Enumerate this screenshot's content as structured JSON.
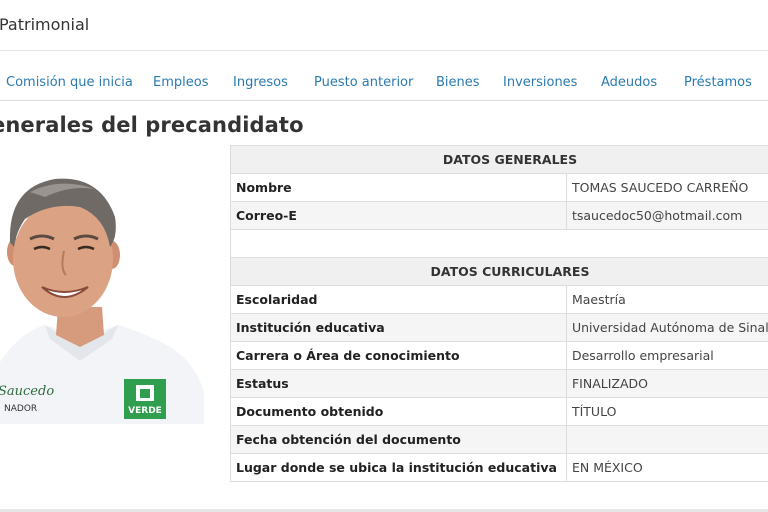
{
  "header": {
    "title": "Patrimonial"
  },
  "tabs": [
    {
      "label": "Comisión que inicia"
    },
    {
      "label": "Empleos"
    },
    {
      "label": "Ingresos"
    },
    {
      "label": "Puesto anterior"
    },
    {
      "label": "Bienes"
    },
    {
      "label": "Inversiones"
    },
    {
      "label": "Adeudos"
    },
    {
      "label": "Préstamos"
    }
  ],
  "section": {
    "title": "enerales del precandidato"
  },
  "photo": {
    "shirt_text": "VERDE",
    "badge_text": "NADOR",
    "signature_text": "Saucedo"
  },
  "generales": {
    "header": "DATOS GENERALES",
    "rows": [
      {
        "label": "Nombre",
        "value": "TOMAS SAUCEDO CARREÑO"
      },
      {
        "label": "Correo-E",
        "value": "tsaucedoc50@hotmail.com"
      }
    ]
  },
  "curriculares": {
    "header": "DATOS CURRICULARES",
    "rows": [
      {
        "label": "Escolaridad",
        "value": "Maestría"
      },
      {
        "label": "Institución educativa",
        "value": "Universidad Autónoma de Sinaloa"
      },
      {
        "label": "Carrera o Área de conocimiento",
        "value": "Desarrollo empresarial"
      },
      {
        "label": "Estatus",
        "value": "FINALIZADO"
      },
      {
        "label": "Documento obtenido",
        "value": "TÍTULO"
      },
      {
        "label": "Fecha obtención del documento",
        "value": ""
      },
      {
        "label": "Lugar donde se ubica la institución educativa",
        "value": "EN MÉXICO"
      }
    ]
  },
  "colors": {
    "link": "#2a7ab0",
    "table_header_bg": "#f0f0f0",
    "row_alt_bg": "#f5f5f5",
    "party_green": "#2f9e4f"
  }
}
